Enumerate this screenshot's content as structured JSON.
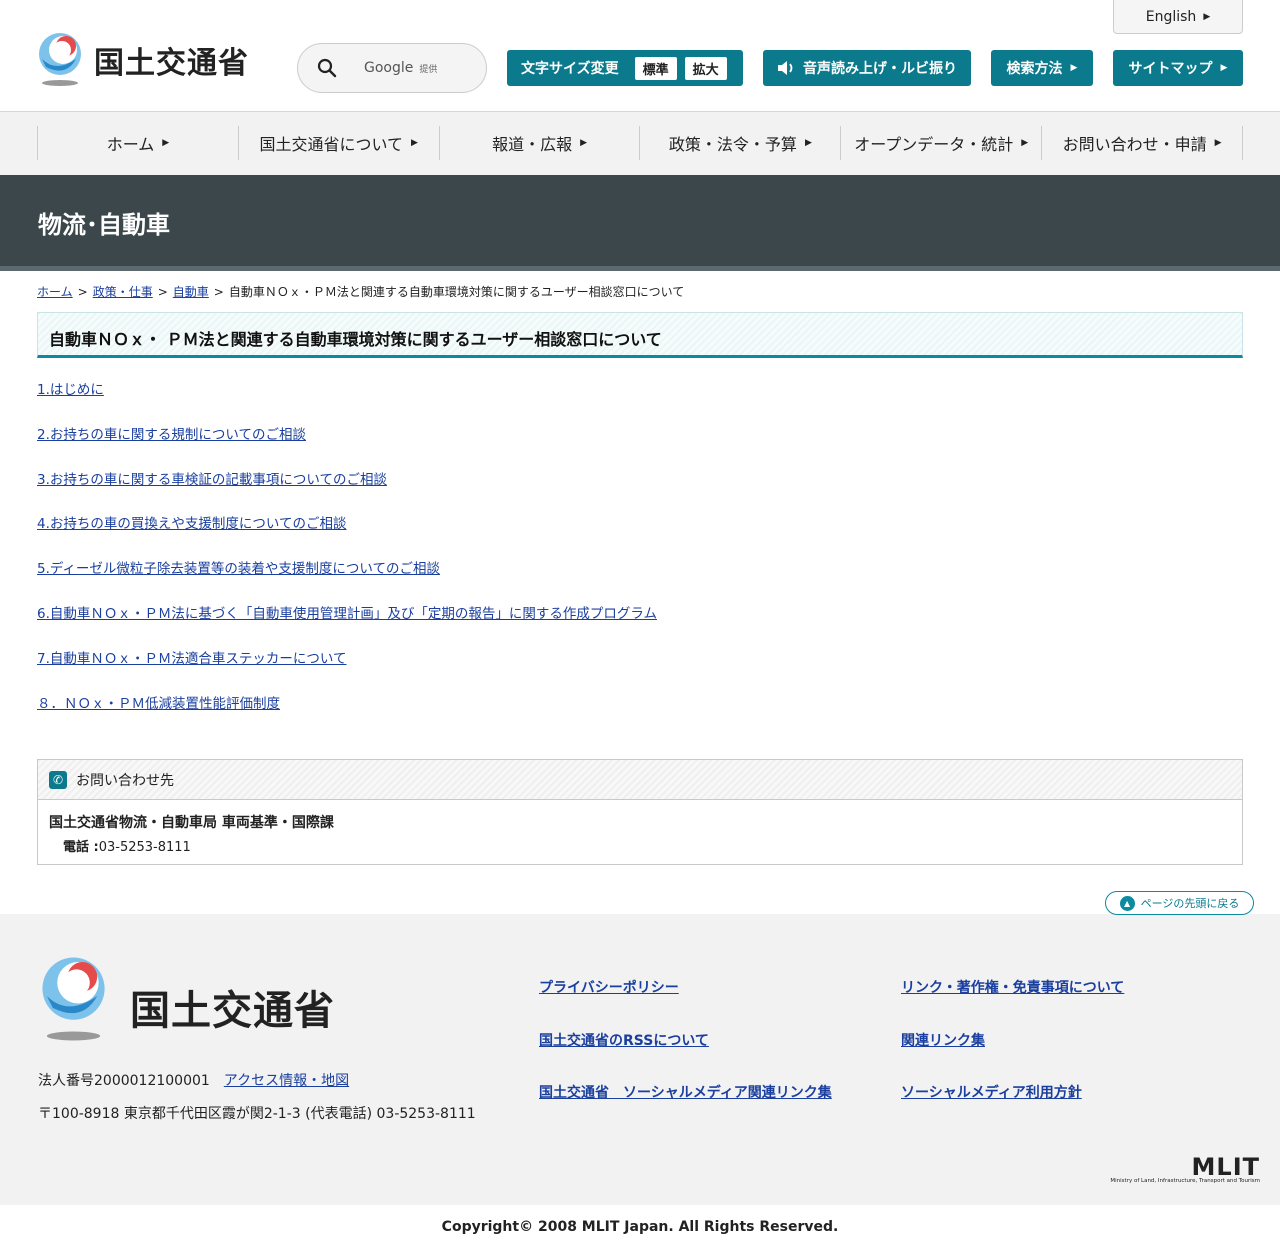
{
  "header": {
    "logo_text": "国土交通省",
    "english_label": "English",
    "search": {
      "label": "Google",
      "sub_label": "提供"
    },
    "text_size": {
      "label": "文字サイズ変更",
      "standard": "標準",
      "large": "拡大"
    },
    "read_aloud_label": "音声読み上げ・ルビ振り",
    "search_method_label": "検索方法",
    "sitemap_label": "サイトマップ"
  },
  "nav": {
    "items": [
      {
        "label": "ホーム"
      },
      {
        "label": "国土交通省について"
      },
      {
        "label": "報道・広報"
      },
      {
        "label": "政策・法令・予算"
      },
      {
        "label": "オープンデータ・統計"
      },
      {
        "label": "お問い合わせ・申請"
      }
    ]
  },
  "band_title": "物流･自動車",
  "breadcrumb": {
    "items": [
      "ホーム",
      "政策・仕事",
      "自動車"
    ],
    "current": "自動車ＮＯｘ・ＰＭ法と関連する自動車環境対策に関するユーザー相談窓口について",
    "sep": ">"
  },
  "page_title": "自動車ＮＯｘ・ ＰＭ法と関連する自動車環境対策に関するユーザー相談窓口について",
  "links": [
    "1.はじめに",
    "2.お持ちの車に関する規制についてのご相談",
    "3.お持ちの車に関する車検証の記載事項についてのご相談",
    "4.お持ちの車の買換えや支援制度についてのご相談",
    "5.ディーゼル微粒子除去装置等の装着や支援制度についてのご相談",
    "6.自動車ＮＯｘ・ＰＭ法に基づく「自動車使用管理計画」及び「定期の報告」に関する作成プログラム",
    "7.自動車ＮＯｘ・ＰＭ法適合車ステッカーについて",
    "８．ＮＯｘ・ＰＭ低減装置性能評価制度"
  ],
  "contact": {
    "heading": "お問い合わせ先",
    "org": "国土交通省物流・自動車局 車両基準・国際課",
    "tel_label": "電話 :",
    "tel": "03-5253-8111"
  },
  "pagetop_label": "ページの先頭に戻る",
  "footer": {
    "logo_text": "国土交通省",
    "corp_number": "法人番号2000012100001",
    "access_label": "アクセス情報・地図",
    "address": "〒100-8918 東京都千代田区霞が関2-1-3 (代表電話) 03-5253-8111",
    "links": {
      "privacy": "プライバシーポリシー",
      "copyright_links": "リンク・著作権・免責事項について",
      "rss": "国土交通省のRSSについて",
      "related": "関連リンク集",
      "social_links": "国土交通省　ソーシャルメディア関連リンク集",
      "social_policy": "ソーシャルメディア利用方針"
    },
    "mlit_logo": "MLIT",
    "mlit_sub": "Ministry of Land, Infrastructure, Transport and Tourism",
    "copyright": "Copyright© 2008 MLIT Japan. All Rights Reserved."
  },
  "colors": {
    "teal": "#0b7a8c",
    "band": "#3c474c",
    "link": "#1a3f9e"
  },
  "icons": {
    "search": "search-icon",
    "speaker": "speaker-icon",
    "phone": "phone-icon",
    "arrow": "triangle-right-icon",
    "pagetop": "arrow-up-icon"
  }
}
